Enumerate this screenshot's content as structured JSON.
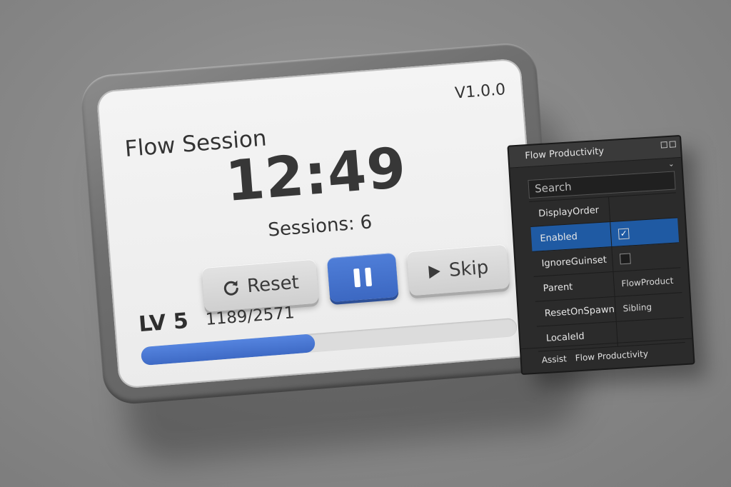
{
  "device": {
    "title": "Flow Session",
    "version": "V1.0.0",
    "timer": "12:49",
    "sessions_label": "Sessions:",
    "sessions_count": "6",
    "buttons": {
      "reset_label": "Reset",
      "reset_icon": "refresh-icon",
      "pause_icon": "pause-icon",
      "skip_label": "Skip",
      "skip_icon": "play-icon"
    },
    "level_label": "LV 5",
    "xp_current": "1189",
    "xp_total": "2571",
    "xp_text": "1189/2571",
    "xp_fraction": 0.462
  },
  "colors": {
    "accent": "#4572d1",
    "panel_bg": "#2b2b2b",
    "panel_selected": "#1f5aa3"
  },
  "panel": {
    "title": "Flow Productivity",
    "search_placeholder": "Search",
    "rows": [
      {
        "name": "DisplayOrder",
        "value": "",
        "type": "text",
        "selected": false
      },
      {
        "name": "Enabled",
        "value": "✓",
        "type": "checkbox",
        "checked": true,
        "selected": true
      },
      {
        "name": "IgnoreGuinset",
        "value": "",
        "type": "checkbox",
        "checked": false,
        "selected": false
      },
      {
        "name": "Parent",
        "value": "FlowProduct",
        "type": "text",
        "selected": false
      },
      {
        "name": "ResetOnSpawn",
        "value": "Sibling",
        "type": "text",
        "selected": false
      },
      {
        "name": "LocaleId",
        "value": "",
        "type": "text",
        "selected": false
      }
    ],
    "footer_left": "Assist",
    "footer_right": "Flow Productivity"
  }
}
